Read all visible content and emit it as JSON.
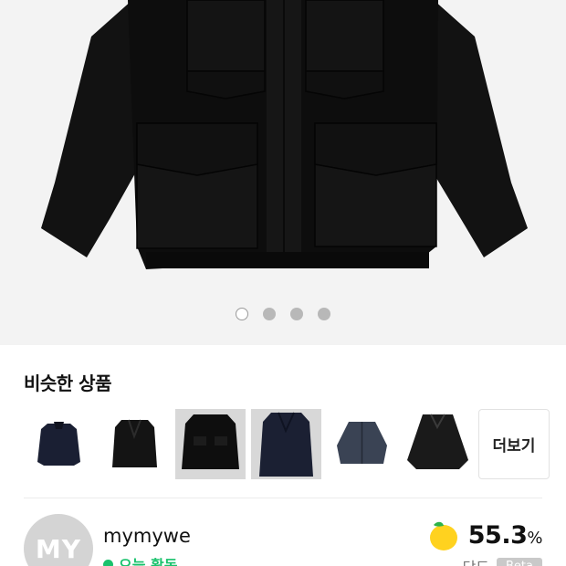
{
  "gallery": {
    "slide_count": 4,
    "active_index": 0
  },
  "similar": {
    "title": "비슷한 상품",
    "more_label": "더보기",
    "items": [
      {
        "color": "#1a1f33",
        "style": "jacket"
      },
      {
        "color": "#141414",
        "style": "coat"
      },
      {
        "color": "#0e0e0e",
        "style": "field"
      },
      {
        "color": "#1b2033",
        "style": "trench"
      },
      {
        "color": "#3a4354",
        "style": "bomber"
      },
      {
        "color": "#1a1a1a",
        "style": "shirt"
      }
    ]
  },
  "seller": {
    "avatar_initials": "MY",
    "name": "mymywe",
    "activity": "오늘 활동",
    "score": "55.3",
    "score_unit": "%",
    "sub_label": "당도",
    "sub_badge": "Beta"
  }
}
